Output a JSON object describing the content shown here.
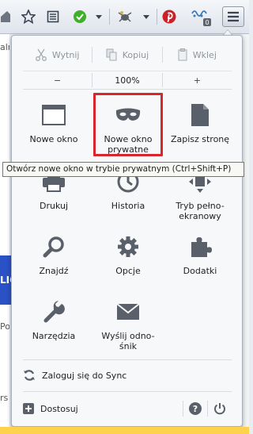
{
  "toolbar": {
    "buttons": [
      "home-icon",
      "bookmark-star-icon",
      "bookmarks-list-icon",
      "addon-green-check-icon",
      "dropdown-arrow-icon",
      "addon-bug-icon",
      "dropdown-arrow-icon",
      "pinterest-icon",
      "addon-signal-icon",
      "menu-icon"
    ],
    "badge": "0"
  },
  "menu": {
    "edit": {
      "cut": "Wytnij",
      "copy": "Kopiuj",
      "paste": "Wklej"
    },
    "zoom": {
      "minus": "−",
      "value": "100%",
      "plus": "+"
    },
    "items": [
      {
        "label": "Nowe okno",
        "icon": "window-icon"
      },
      {
        "label": "Nowe okno prywatne",
        "icon": "private-mask-icon"
      },
      {
        "label": "Zapisz stronę",
        "icon": "save-page-icon"
      },
      {
        "label": "Drukuj",
        "icon": "print-icon"
      },
      {
        "label": "Historia",
        "icon": "history-icon"
      },
      {
        "label": "Tryb pełno-ekranowy",
        "icon": "fullscreen-icon"
      },
      {
        "label": "Znajdź",
        "icon": "search-icon"
      },
      {
        "label": "Opcje",
        "icon": "gear-icon"
      },
      {
        "label": "Dodatki",
        "icon": "puzzle-icon"
      },
      {
        "label": "Narzędzia",
        "icon": "wrench-icon"
      },
      {
        "label": "Wyślij odno-śnik",
        "icon": "envelope-icon"
      }
    ],
    "sync": "Zaloguj się do Sync",
    "customize": "Dostosuj"
  },
  "tooltip": "Otwórz nowe okno w trybie prywatnym (Ctrl+Shift+P)",
  "background": {
    "fragments": [
      "aln",
      "LIC",
      "Po",
      "rs"
    ]
  },
  "colors": {
    "highlight": "#d9262c",
    "pinterest": "#cb2027",
    "addon_green": "#3fae2a"
  }
}
